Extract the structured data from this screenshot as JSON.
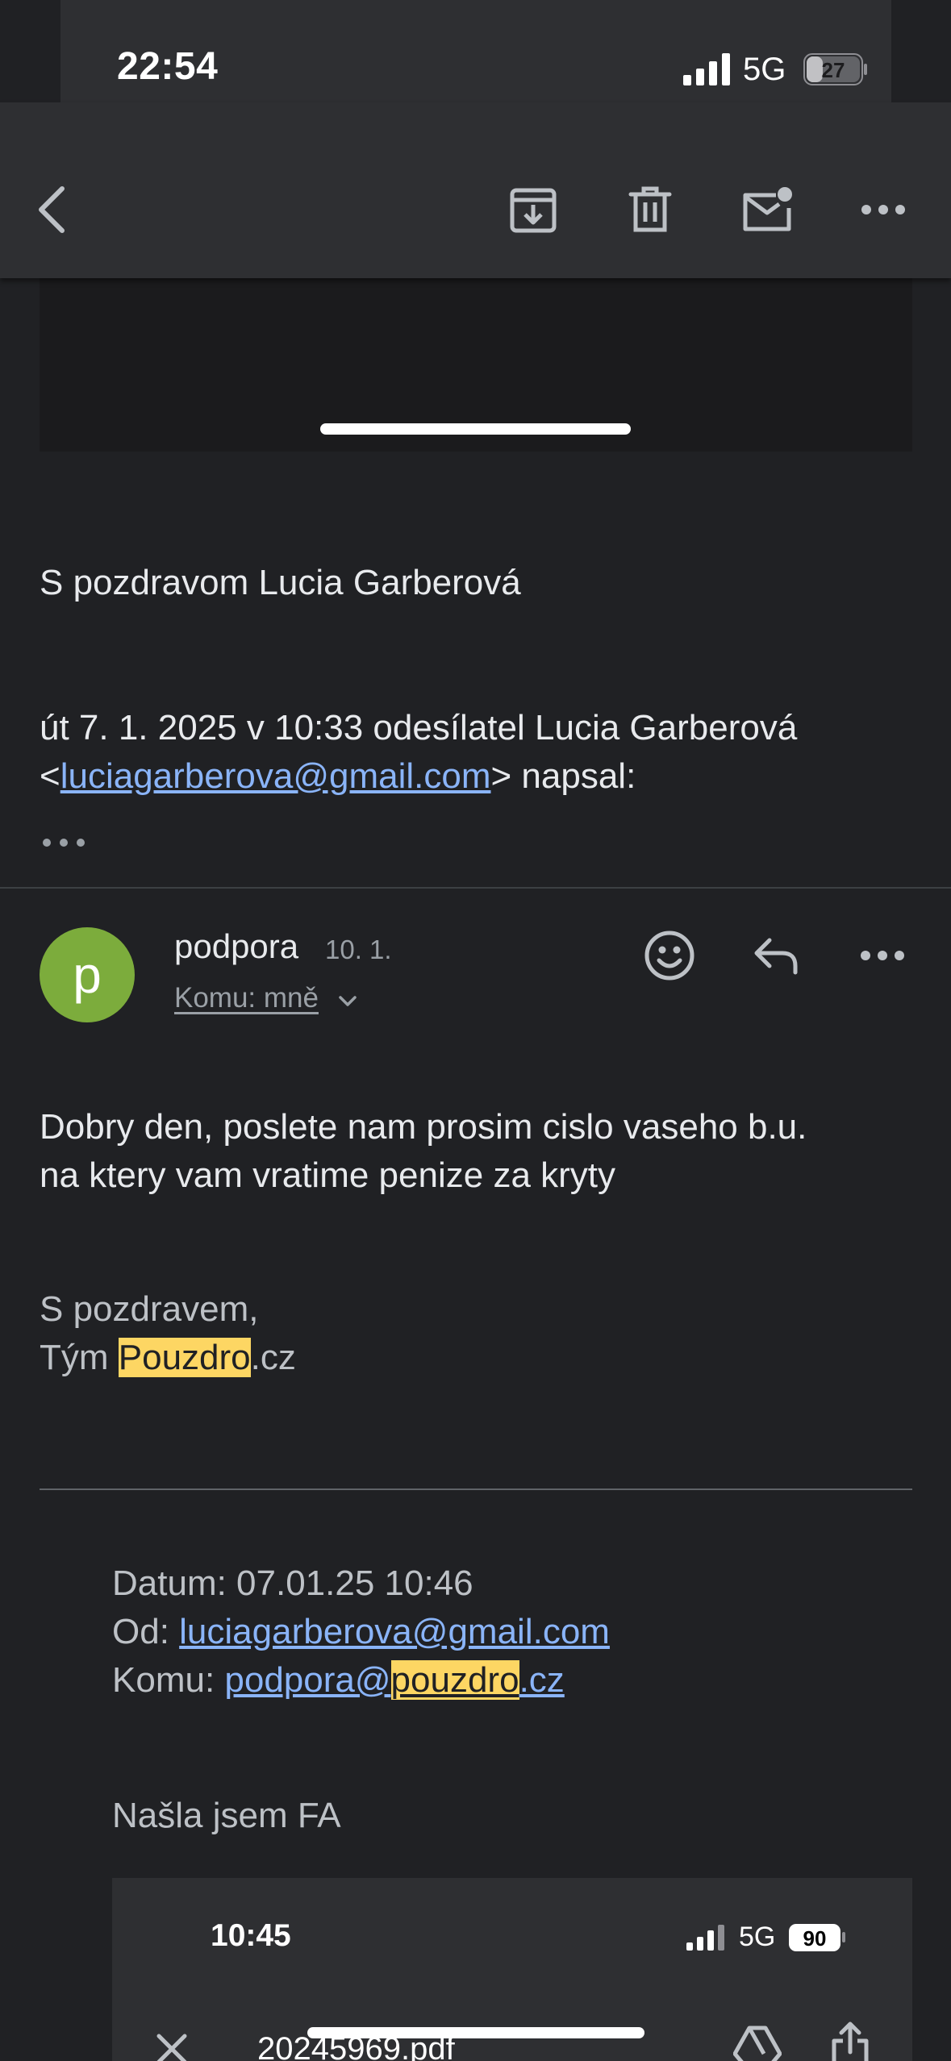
{
  "status_bar": {
    "time": "22:54",
    "network": "5G",
    "battery": "27"
  },
  "toolbar": {
    "back_icon": "chevron-left-icon",
    "archive_icon": "archive-icon",
    "delete_icon": "trash-icon",
    "unread_icon": "mark-unread-icon",
    "more_icon": "more-horizontal-icon"
  },
  "quoted": {
    "signoff": "S pozdravom Lucia Garberová",
    "attribution_prefix": "út 7. 1. 2025 v 10:33 odesílatel Lucia Garberová",
    "attribution_lt": "<",
    "attribution_email": "luciagarberova@gmail.com",
    "attribution_suffix": "> napsal:"
  },
  "message": {
    "avatar_letter": "p",
    "avatar_color": "#7cac3c",
    "sender": "podpora",
    "date": "10. 1.",
    "recipient": "Komu: mně",
    "body_line1": "Dobry den, poslete nam prosim cislo vaseho b.u.",
    "body_line2": "na ktery vam vratime penize za kryty",
    "signature_greeting": "S pozdravem,",
    "signature_team_prefix": "Tým ",
    "signature_team_highlight": "Pouzdro",
    "signature_team_suffix": ".cz",
    "highlight_color": "#fdd663"
  },
  "forwarded": {
    "date_label": "Datum: 07.01.25 10:46",
    "from_label": "Od: ",
    "from_email": "luciagarberova@gmail.com",
    "to_label": "Komu: ",
    "to_email_prefix": "podpora@",
    "to_email_highlight": "pouzdro",
    "to_email_suffix": ".cz",
    "body": "Našla jsem FA"
  },
  "embedded_screenshot": {
    "time": "10:45",
    "network": "5G",
    "battery": "90",
    "filename": "20245969.pdf"
  }
}
